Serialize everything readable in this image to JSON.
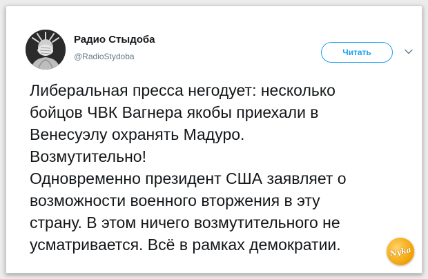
{
  "tweet": {
    "author": {
      "display_name": "Радио Стыдоба",
      "handle": "@RadioStydoba",
      "avatar_icon": "statue-of-liberty-facepalm-avatar"
    },
    "follow_label": "Читать",
    "menu_icon": "chevron-down-icon",
    "text_lines": [
      "Либеральная пресса негодует: несколько",
      "бойцов ЧВК Вагнера якобы приехали в",
      "Венесуэлу охранять Мадуро.",
      "Возмутительно!",
      "Одновременно президент США заявляет о",
      "возможности военного вторжения в эту",
      "страну. В этом ничего возмутительного не",
      "усматривается. Всё в рамках демократии."
    ]
  },
  "watermark": {
    "text": "Nyka"
  },
  "colors": {
    "accent": "#1da1f2",
    "text": "#14171a",
    "secondary": "#657786",
    "background": "#ffffff",
    "outer": "#ececec"
  }
}
